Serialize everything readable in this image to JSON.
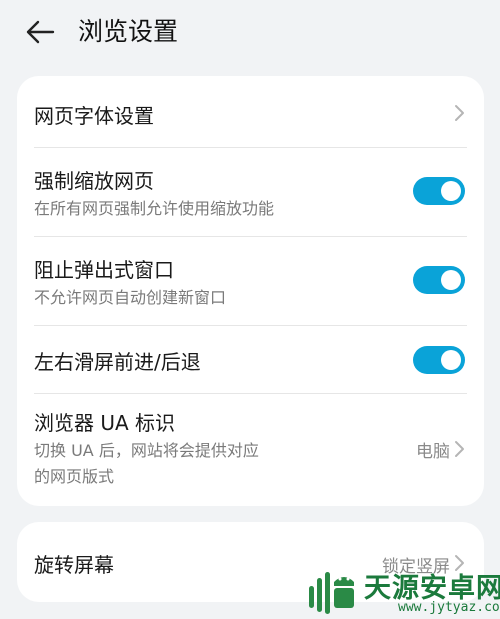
{
  "header": {
    "title": "浏览设置",
    "back_icon": "arrow-left-icon"
  },
  "settings": {
    "font_settings": {
      "title": "网页字体设置"
    },
    "force_zoom": {
      "title": "强制缩放网页",
      "subtitle": "在所有网页强制允许使用缩放功能",
      "enabled": true
    },
    "block_popups": {
      "title": "阻止弹出式窗口",
      "subtitle": "不允许网页自动创建新窗口",
      "enabled": true
    },
    "swipe_nav": {
      "title": "左右滑屏前进/后退",
      "enabled": true
    },
    "user_agent": {
      "title": "浏览器 UA 标识",
      "subtitle_line1": "切换 UA 后，网站将会提供对应",
      "subtitle_line2": "的网页版式",
      "value": "电脑"
    }
  },
  "rotation": {
    "title": "旋转屏幕",
    "value": "锁定竖屏"
  },
  "watermark": {
    "name": "天源安卓网",
    "url": "www.jytyaz.com"
  },
  "colors": {
    "accent": "#0aa3d8",
    "background": "#f1f3f5",
    "card": "#ffffff",
    "watermark_green": "#1b7a3c"
  }
}
